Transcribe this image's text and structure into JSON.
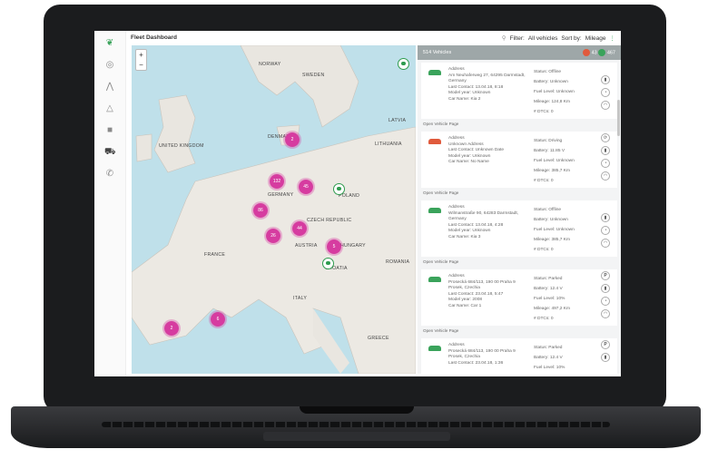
{
  "header": {
    "title": "Fleet Dashboard",
    "filter_label": "Filter:",
    "filter_value": "All vehicles",
    "sort_label": "Sort by:",
    "sort_value": "Mileage"
  },
  "map": {
    "zoom_in": "+",
    "zoom_out": "−",
    "countries": [
      {
        "name": "NORWAY"
      },
      {
        "name": "SWEDEN"
      },
      {
        "name": "UNITED KINGDOM"
      },
      {
        "name": "DENMARK"
      },
      {
        "name": "GERMANY"
      },
      {
        "name": "POLAND"
      },
      {
        "name": "FRANCE"
      },
      {
        "name": "ITALY"
      },
      {
        "name": "AUSTRIA"
      },
      {
        "name": "HUNGARY"
      },
      {
        "name": "ROMANIA"
      },
      {
        "name": "GREECE"
      },
      {
        "name": "LATVIA"
      },
      {
        "name": "LITHUANIA"
      },
      {
        "name": "CZECH REPUBLIC"
      },
      {
        "name": "CROATIA"
      }
    ],
    "clusters": [
      "2",
      "132",
      "45",
      "86",
      "44",
      "26",
      "5",
      "2",
      "6"
    ]
  },
  "panel": {
    "count": "514 Vehicles",
    "offline_count": "43",
    "online_count": "467",
    "open_link": "Open Vehicle Page",
    "cards": [
      {
        "address_label": "Address",
        "address": "Am Neuhaferweg 27, 64295 Darmstadt, Germany",
        "last_contact": "Last Contact: 13.04.18, 8:18",
        "model": "Model year: Unknown",
        "car_name": "Car Name: Kia 2",
        "status": "Status: Offline",
        "battery": "Battery: Unknown",
        "fuel": "Fuel Level: Unknown",
        "mileage": "Mileage: 124,8 Km",
        "dtcs": "# DTCs: 0",
        "car_color": "#3aa35b"
      },
      {
        "address_label": "Address",
        "address": "Unknown Address",
        "last_contact": "Last Contact: Unknown Date",
        "model": "Model year: Unknown",
        "car_name": "Car Name: No Name",
        "status": "Status: Driving",
        "battery": "Battery: 11.85 V",
        "fuel": "Fuel Level: Unknown",
        "mileage": "Mileage: 385,7 Km",
        "dtcs": "# DTCs: 0",
        "car_color": "#e05a3c"
      },
      {
        "address_label": "Address",
        "address": "Wilmanstraße 90, 64283 Darmstadt, Germany",
        "last_contact": "Last Contact: 13.04.18, 4:28",
        "model": "Model year: Unknown",
        "car_name": "Car Name: Kia 3",
        "status": "Status: Offline",
        "battery": "Battery: Unknown",
        "fuel": "Fuel Level: Unknown",
        "mileage": "Mileage: 385,7 Km",
        "dtcs": "# DTCs: 0",
        "car_color": "#3aa35b"
      },
      {
        "address_label": "Address",
        "address": "Prosecká 684/113, 190 00 Praha 9 Prosek, Czechia",
        "last_contact": "Last Contact: 23.04.18, 5:47",
        "model": "Model year: 2008",
        "car_name": "Car Name: Car 1",
        "status": "Status: Parked",
        "battery": "Battery: 12.4 V",
        "fuel": "Fuel Level: 10%",
        "mileage": "Mileage: 497,2 Km",
        "dtcs": "# DTCs: 0",
        "car_color": "#3aa35b"
      },
      {
        "address_label": "Address",
        "address": "Prosecká 684/113, 190 00 Praha 9 Prosek, Czechia",
        "last_contact": "Last Contact: 23.04.18, 1:36",
        "model": "",
        "car_name": "",
        "status": "Status: Parked",
        "battery": "Battery: 12.4 V",
        "fuel": "Fuel Level: 10%",
        "mileage": "",
        "dtcs": "",
        "car_color": "#3aa35b"
      }
    ]
  }
}
